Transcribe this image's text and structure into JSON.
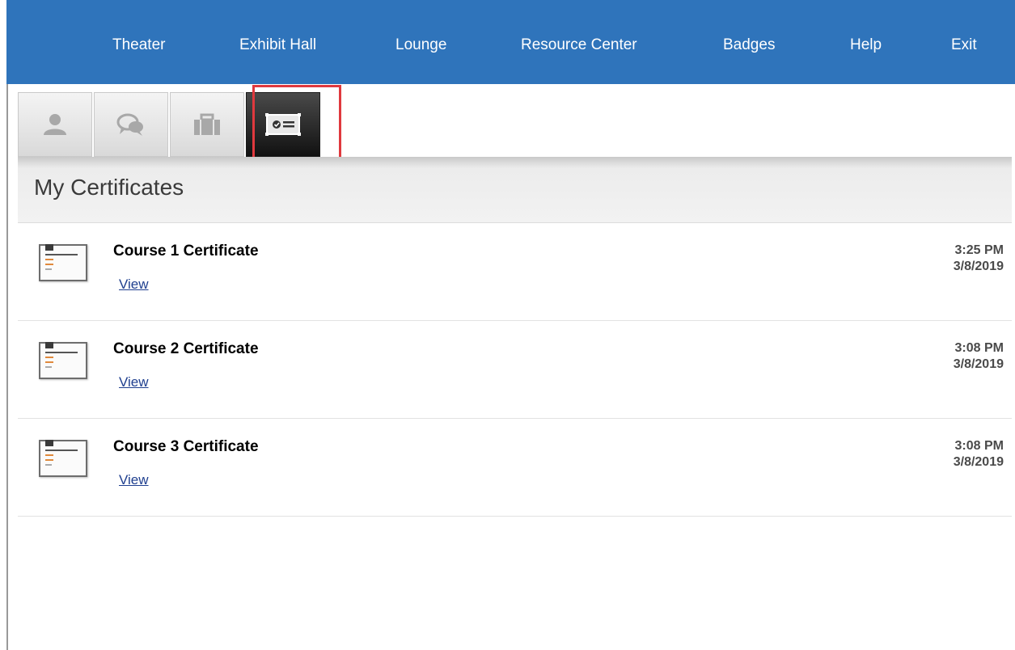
{
  "nav": {
    "items": [
      {
        "label": "Theater"
      },
      {
        "label": "Exhibit Hall"
      },
      {
        "label": "Lounge"
      },
      {
        "label": "Resource Center"
      },
      {
        "label": "Badges"
      },
      {
        "label": "Help"
      },
      {
        "label": "Exit"
      }
    ]
  },
  "tabs": [
    {
      "icon": "user-profile-icon",
      "active": false
    },
    {
      "icon": "chat-bubbles-icon",
      "active": false
    },
    {
      "icon": "briefcase-icon",
      "active": false
    },
    {
      "icon": "certificate-icon",
      "active": true
    }
  ],
  "colors": {
    "nav_bg": "#2f74bb",
    "highlight": "#e0393e",
    "link": "#1f3f8f"
  },
  "section": {
    "title": "My Certificates"
  },
  "certificates": [
    {
      "title": "Course 1 Certificate",
      "link": "View",
      "time": "3:25 PM",
      "date": "3/8/2019"
    },
    {
      "title": "Course 2 Certificate",
      "link": "View",
      "time": "3:08 PM",
      "date": "3/8/2019"
    },
    {
      "title": "Course 3 Certificate",
      "link": "View",
      "time": "3:08 PM",
      "date": "3/8/2019"
    }
  ]
}
